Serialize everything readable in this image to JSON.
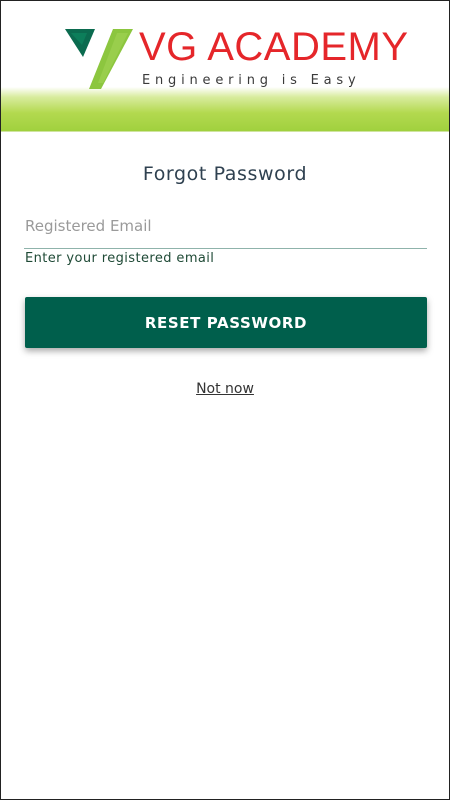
{
  "header": {
    "brand_name": "VG ACADEMY",
    "tagline": "Engineering is Easy",
    "logo_icon": "vg-logo-icon"
  },
  "form": {
    "title": "Forgot Password",
    "email_placeholder": "Registered Email",
    "email_value": "",
    "hint": "Enter your registered email",
    "reset_label": "RESET PASSWORD",
    "not_now_label": "Not now"
  },
  "colors": {
    "brand_red": "#e5262a",
    "logo_green_dark": "#005f4c",
    "logo_green_light": "#8cc63f",
    "button_bg": "#005f4c",
    "header_gradient": "#9fd03d"
  }
}
